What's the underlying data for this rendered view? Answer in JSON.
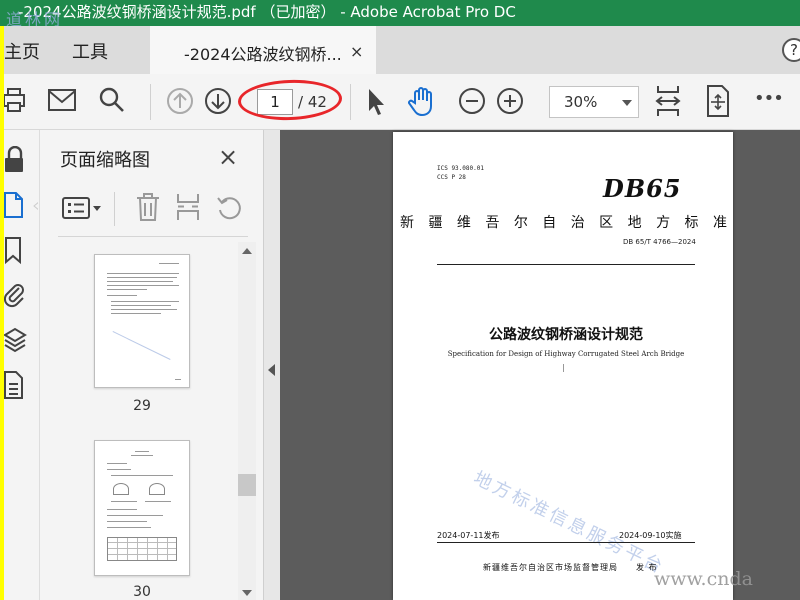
{
  "window": {
    "title": "-2024公路波纹钢桥涵设计规范.pdf （已加密） - Adobe Acrobat Pro DC",
    "watermark_topleft": "道林网"
  },
  "tabs": {
    "home": "主页",
    "tools": "工具",
    "doc_title": "-2024公路波纹钢桥...",
    "close_glyph": "×",
    "help_glyph": "?"
  },
  "toolbar": {
    "current_page": "1",
    "total_pages": "/ 42",
    "zoom": "30%",
    "more_glyph": "•••"
  },
  "thumbnails": {
    "title": "页面缩略图",
    "close_glyph": "×",
    "pages": [
      {
        "label": "29"
      },
      {
        "label": "30"
      }
    ]
  },
  "document": {
    "ics_line1": "ICS  93.080.01",
    "ics_line2": "CCS  P  28",
    "db_logo": "DB65",
    "std_region": "新 疆 维 吾 尔 自 治 区 地 方 标 准",
    "std_number": "DB 65/T 4766—2024",
    "title_cn": "公路波纹钢桥涵设计规范",
    "title_en": "Specification for Design of Highway Corrugated Steel Arch Bridge",
    "release_date": "2024-07-11发布",
    "impl_date": "2024-09-10实施",
    "issuer": "新疆维吾尔自治区市场监督管理局　　发 布",
    "watermark": "地方标准信息服务平台"
  },
  "site_watermark": "www.cnda"
}
